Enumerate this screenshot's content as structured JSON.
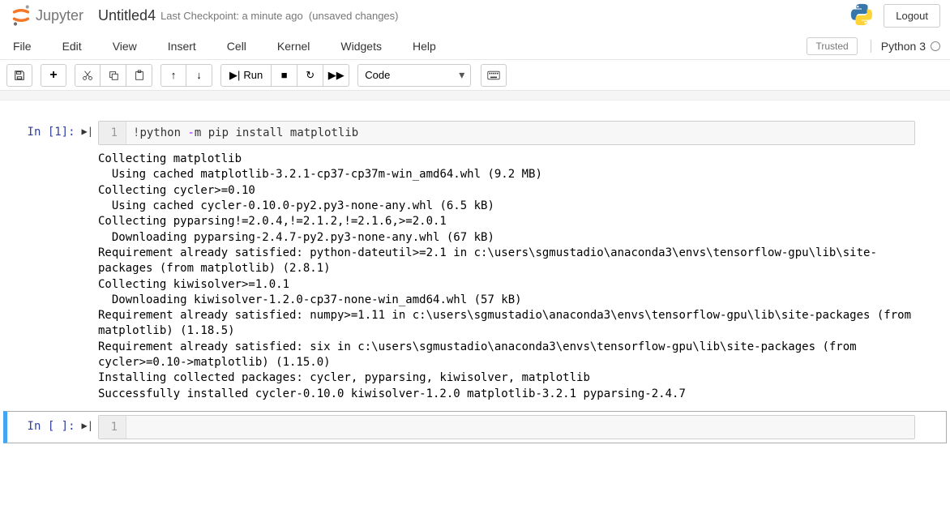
{
  "header": {
    "logo_text": "Jupyter",
    "notebook_name": "Untitled4",
    "checkpoint": "Last Checkpoint: a minute ago",
    "unsaved": "(unsaved changes)",
    "logout": "Logout"
  },
  "menubar": {
    "items": [
      "File",
      "Edit",
      "View",
      "Insert",
      "Cell",
      "Kernel",
      "Widgets",
      "Help"
    ],
    "trusted": "Trusted",
    "kernel": "Python 3"
  },
  "toolbar": {
    "run_label": "Run",
    "celltype": "Code"
  },
  "cells": [
    {
      "prompt": "In [1]:",
      "line_number": "1",
      "code": "!python -m pip install matplotlib",
      "output": "Collecting matplotlib\n  Using cached matplotlib-3.2.1-cp37-cp37m-win_amd64.whl (9.2 MB)\nCollecting cycler>=0.10\n  Using cached cycler-0.10.0-py2.py3-none-any.whl (6.5 kB)\nCollecting pyparsing!=2.0.4,!=2.1.2,!=2.1.6,>=2.0.1\n  Downloading pyparsing-2.4.7-py2.py3-none-any.whl (67 kB)\nRequirement already satisfied: python-dateutil>=2.1 in c:\\users\\sgmustadio\\anaconda3\\envs\\tensorflow-gpu\\lib\\site-packages (from matplotlib) (2.8.1)\nCollecting kiwisolver>=1.0.1\n  Downloading kiwisolver-1.2.0-cp37-none-win_amd64.whl (57 kB)\nRequirement already satisfied: numpy>=1.11 in c:\\users\\sgmustadio\\anaconda3\\envs\\tensorflow-gpu\\lib\\site-packages (from matplotlib) (1.18.5)\nRequirement already satisfied: six in c:\\users\\sgmustadio\\anaconda3\\envs\\tensorflow-gpu\\lib\\site-packages (from cycler>=0.10->matplotlib) (1.15.0)\nInstalling collected packages: cycler, pyparsing, kiwisolver, matplotlib\nSuccessfully installed cycler-0.10.0 kiwisolver-1.2.0 matplotlib-3.2.1 pyparsing-2.4.7"
    },
    {
      "prompt": "In [ ]:",
      "line_number": "1",
      "code": "",
      "output": null
    }
  ]
}
